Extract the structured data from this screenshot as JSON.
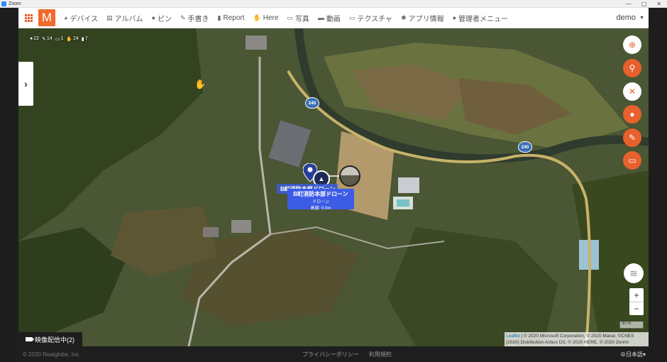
{
  "window": {
    "title": "Zoom",
    "controls": [
      "—",
      "▢",
      "✕"
    ]
  },
  "nav": {
    "items": [
      {
        "icon": "device-icon",
        "glyph": "◕",
        "label": "デバイス"
      },
      {
        "icon": "album-icon",
        "glyph": "▤",
        "label": "アルバム"
      },
      {
        "icon": "pin-icon",
        "glyph": "●",
        "label": "ピン"
      },
      {
        "icon": "pen-icon",
        "glyph": "✎",
        "label": "手書き"
      },
      {
        "icon": "report-icon",
        "glyph": "▮",
        "label": "Report"
      },
      {
        "icon": "here-icon",
        "glyph": "✋",
        "label": "Here"
      },
      {
        "icon": "photo-icon",
        "glyph": "▭",
        "label": "写真"
      },
      {
        "icon": "video-icon",
        "glyph": "▬",
        "label": "動画"
      },
      {
        "icon": "texture-icon",
        "glyph": "▭",
        "label": "テクスチャ"
      },
      {
        "icon": "app-info-icon",
        "glyph": "✱",
        "label": "アプリ情報"
      },
      {
        "icon": "admin-icon",
        "glyph": "●",
        "label": "管理者メニュー"
      }
    ],
    "user": "demo"
  },
  "counts": {
    "pins": "22",
    "drawings": "14",
    "devices": "1",
    "here": "24",
    "reports": "7"
  },
  "markers": {
    "label_back": "B町消防本部ドローン",
    "label_title": "B町消防本部ドローン",
    "label_sub1": "ドローン",
    "label_sub2": "高度: 0.0m"
  },
  "road_signs": [
    "240",
    "240"
  ],
  "controls": {
    "zoom_in": "+",
    "zoom_out": "−",
    "scale": "30 m"
  },
  "attribution": {
    "link": "Leaflet",
    "text": " | © 2020 Microsoft Corporation, © 2020 Maxar, ©CNES (2020) Distribution Airbus DS, © 2020 HERE, © 2020 Zenrin"
  },
  "stream_label": "映像配信中(2)",
  "footer": {
    "copyright": "© 2020 Realglobe, Inc",
    "privacy": "プライバシーポリシー",
    "terms": "利用規約",
    "language": "⊕日本語▾"
  },
  "colors": {
    "accent": "#e8602c",
    "marker_label": "#3d5ce6",
    "road_sign": "#3b6fb6"
  }
}
